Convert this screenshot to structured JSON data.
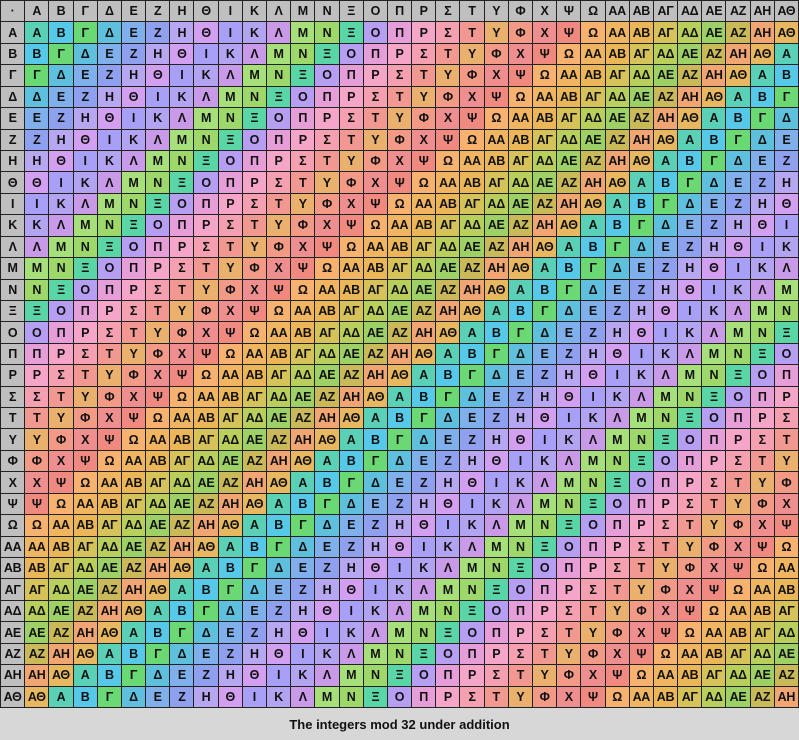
{
  "caption": "The integers mod 32 under addition",
  "corner_symbol": "·",
  "elements": [
    "Α",
    "Β",
    "Γ",
    "Δ",
    "Ε",
    "Ζ",
    "Η",
    "Θ",
    "Ι",
    "Κ",
    "Λ",
    "Μ",
    "Ν",
    "Ξ",
    "Ο",
    "Π",
    "Ρ",
    "Σ",
    "Τ",
    "Υ",
    "Φ",
    "Χ",
    "Ψ",
    "Ω",
    "ΑΑ",
    "ΑΒ",
    "ΑΓ",
    "ΑΔ",
    "ΑΕ",
    "ΑΖ",
    "ΑΗ",
    "ΑΘ"
  ],
  "colors": {
    "header": "#bfbfbf",
    "Α": "#5ad1b6",
    "Β": "#56c9e8",
    "Γ": "#6ad873",
    "Δ": "#5fc0de",
    "Ε": "#7fb0ec",
    "Ζ": "#8fa0ee",
    "Η": "#b7a6f0",
    "Θ": "#d39ff0",
    "Ι": "#a7a0f6",
    "Κ": "#b3a4f2",
    "Λ": "#c89ae8",
    "Μ": "#a7e07a",
    "Ν": "#9fd86a",
    "Ξ": "#5ad6a6",
    "Ο": "#b69ef2",
    "Π": "#e69ed8",
    "Ρ": "#f4a5c8",
    "Σ": "#f4a0b0",
    "Τ": "#f19890",
    "Υ": "#e9b06e",
    "Φ": "#f29a86",
    "Χ": "#ee8e8e",
    "Ψ": "#f08a80",
    "Ω": "#f6b26e",
    "ΑΑ": "#f0b560",
    "ΑΒ": "#eab658",
    "ΑΓ": "#d5c35a",
    "ΑΔ": "#b9cf5c",
    "ΑΕ": "#9dd065",
    "ΑΖ": "#c9b958",
    "ΑΗ": "#f0a572",
    "ΑΘ": "#e7b860"
  }
}
